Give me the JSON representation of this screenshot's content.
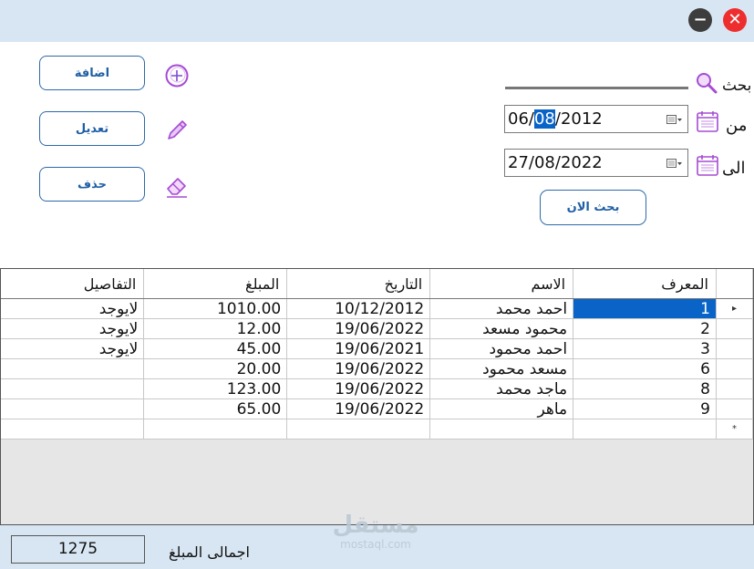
{
  "window": {
    "minimize_glyph": "−",
    "close_glyph": "✕"
  },
  "actions": {
    "add_label": "اضافة",
    "edit_label": "تعديل",
    "delete_label": "حذف"
  },
  "search": {
    "label": "بحث",
    "from_label": "من",
    "to_label": "الى",
    "from_date": {
      "before": "06/",
      "selected": "08",
      "after": "/2012"
    },
    "to_date": "27/08/2022",
    "search_now_label": "بحث الان"
  },
  "grid": {
    "columns": [
      "المعرف",
      "الاسم",
      "التاريخ",
      "المبلغ",
      "التفاصيل"
    ],
    "rows": [
      {
        "id": "1",
        "name": "احمد محمد",
        "date": "10/12/2012",
        "amount": "1010.00",
        "details": "لايوجد"
      },
      {
        "id": "2",
        "name": "محمود مسعد",
        "date": "19/06/2022",
        "amount": "12.00",
        "details": "لايوجد"
      },
      {
        "id": "3",
        "name": "احمد محمود",
        "date": "19/06/2021",
        "amount": "45.00",
        "details": "لايوجد"
      },
      {
        "id": "6",
        "name": "مسعد محمود",
        "date": "19/06/2022",
        "amount": "20.00",
        "details": ""
      },
      {
        "id": "8",
        "name": "ماجد محمد",
        "date": "19/06/2022",
        "amount": "123.00",
        "details": ""
      },
      {
        "id": "9",
        "name": "ماهر",
        "date": "19/06/2022",
        "amount": "65.00",
        "details": ""
      }
    ],
    "current_row_marker": "▸",
    "new_row_marker": "*"
  },
  "footer": {
    "total_label": "اجمالى المبلغ",
    "total_value": "1275"
  },
  "watermark": {
    "arabic": "مستقل",
    "latin": "mostaql.com"
  },
  "colors": {
    "accent": "#0a64c8",
    "titlebar": "#d8e6f3",
    "close": "#ee2e2e",
    "icon_purple": "#a64bd4"
  }
}
